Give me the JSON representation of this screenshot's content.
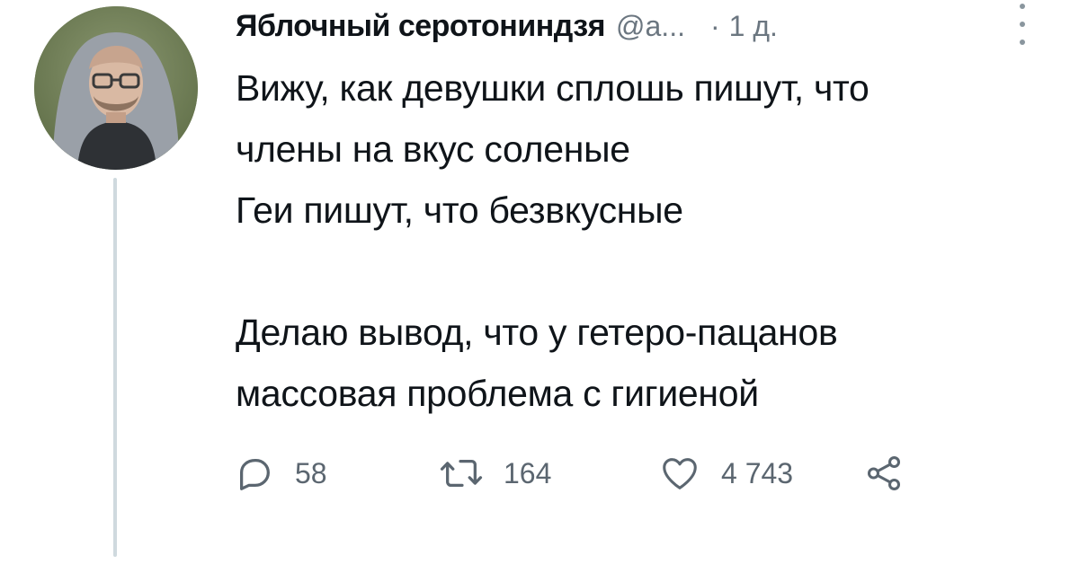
{
  "tweet": {
    "author": {
      "name": "Яблочный серотониндзя",
      "handle": "@а...",
      "avatar_icon": "user-avatar"
    },
    "separator": "·",
    "timestamp": "1 д.",
    "more_icon": "more-vertical-icon",
    "lines": [
      "Вижу, как девушки сплошь пишут, что",
      "члены на вкус соленые",
      "Геи пишут, что безвкусные",
      "",
      "Делаю вывод, что у гетеро-пацанов",
      "массовая проблема с гигиеной"
    ],
    "actions": {
      "replies": {
        "icon": "reply-icon",
        "count": "58"
      },
      "retweets": {
        "icon": "retweet-icon",
        "count": "164"
      },
      "likes": {
        "icon": "heart-icon",
        "count": "4 743"
      },
      "share": {
        "icon": "share-icon"
      }
    }
  },
  "colors": {
    "text": "#0f1419",
    "muted": "#6b7680",
    "thread_line": "#cfd9de"
  }
}
